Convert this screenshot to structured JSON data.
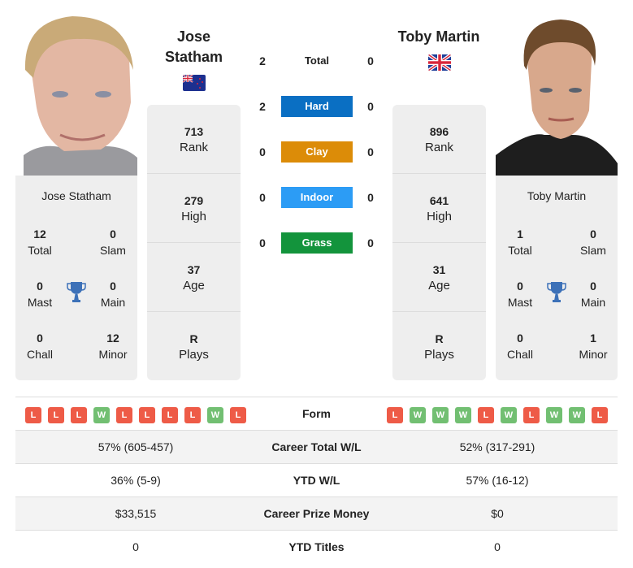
{
  "colors": {
    "hard": "#0a6fc3",
    "clay": "#dc8c08",
    "indoor": "#2c9cf5",
    "grass": "#13943c",
    "win": "#72bf72",
    "loss": "#ee5b47",
    "trophy": "#3d71b8"
  },
  "players": {
    "left": {
      "name": "Jose Statham",
      "header_lines": [
        "Jose",
        "Statham"
      ],
      "flag": "new-zealand-flag-icon",
      "stats": [
        {
          "value": "713",
          "label": "Rank"
        },
        {
          "value": "279",
          "label": "High"
        },
        {
          "value": "37",
          "label": "Age"
        },
        {
          "value": "R",
          "label": "Plays"
        }
      ],
      "titles": {
        "total": {
          "value": "12",
          "label": "Total"
        },
        "slam": {
          "value": "0",
          "label": "Slam"
        },
        "mast": {
          "value": "0",
          "label": "Mast"
        },
        "main": {
          "value": "0",
          "label": "Main"
        },
        "chall": {
          "value": "0",
          "label": "Chall"
        },
        "minor": {
          "value": "12",
          "label": "Minor"
        }
      },
      "form": [
        "L",
        "L",
        "L",
        "W",
        "L",
        "L",
        "L",
        "L",
        "W",
        "L"
      ]
    },
    "right": {
      "name": "Toby Martin",
      "header_lines": [
        "Toby Martin"
      ],
      "flag": "united-kingdom-flag-icon",
      "stats": [
        {
          "value": "896",
          "label": "Rank"
        },
        {
          "value": "641",
          "label": "High"
        },
        {
          "value": "31",
          "label": "Age"
        },
        {
          "value": "R",
          "label": "Plays"
        }
      ],
      "titles": {
        "total": {
          "value": "1",
          "label": "Total"
        },
        "slam": {
          "value": "0",
          "label": "Slam"
        },
        "mast": {
          "value": "0",
          "label": "Mast"
        },
        "main": {
          "value": "0",
          "label": "Main"
        },
        "chall": {
          "value": "0",
          "label": "Chall"
        },
        "minor": {
          "value": "1",
          "label": "Minor"
        }
      },
      "form": [
        "L",
        "W",
        "W",
        "W",
        "L",
        "W",
        "L",
        "W",
        "W",
        "L"
      ]
    }
  },
  "h2h": [
    {
      "label": "Total",
      "left": "2",
      "right": "0",
      "type": "total"
    },
    {
      "label": "Hard",
      "left": "2",
      "right": "0",
      "type": "hard"
    },
    {
      "label": "Clay",
      "left": "0",
      "right": "0",
      "type": "clay"
    },
    {
      "label": "Indoor",
      "left": "0",
      "right": "0",
      "type": "indoor"
    },
    {
      "label": "Grass",
      "left": "0",
      "right": "0",
      "type": "grass"
    }
  ],
  "comparison": {
    "form_label": "Form",
    "rows": [
      {
        "label": "Career Total W/L",
        "left": "57% (605-457)",
        "right": "52% (317-291)"
      },
      {
        "label": "YTD W/L",
        "left": "36% (5-9)",
        "right": "57% (16-12)"
      },
      {
        "label": "Career Prize Money",
        "left": "$33,515",
        "right": "$0"
      },
      {
        "label": "YTD Titles",
        "left": "0",
        "right": "0"
      }
    ]
  }
}
